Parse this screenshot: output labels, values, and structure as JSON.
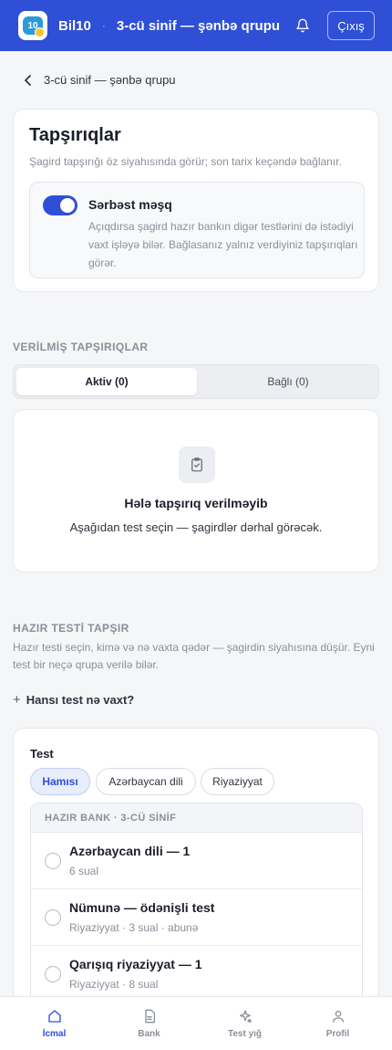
{
  "header": {
    "logo_text": "10",
    "brand": "Bil10",
    "separator": "·",
    "group_title": "3-cü sinif — şənbə qrupu",
    "logout_label": "Çıxış",
    "bell_icon": "bell-icon"
  },
  "breadcrumb": {
    "back_label": "3-cü sinif — şənbə qrupu"
  },
  "tasks_card": {
    "title": "Tapşırıqlar",
    "subtitle": "Şagird tapşırığı öz siyahısında görür; son tarix keçəndə bağlanır.",
    "practice": {
      "enabled": true,
      "title": "Sərbəst məşq",
      "description": "Açıqdırsa şagird hazır bankın digər testlərini də istədiyi vaxt işləyə bilər. Bağlasanız yalnız verdiyiniz tapşırıqları görər."
    }
  },
  "assigned": {
    "section_label": "VERİLMİŞ TAPŞIRIQLAR",
    "tabs": [
      {
        "label": "Aktiv (0)",
        "active": true
      },
      {
        "label": "Bağlı (0)",
        "active": false
      }
    ],
    "empty": {
      "icon": "clipboard-check-icon",
      "title": "Hələ tapşırıq verilməyib",
      "description": "Aşağıdan test seçin — şagirdlər dərhal görəcək."
    }
  },
  "assign": {
    "section_label": "HAZIR TESTİ TAPŞIR",
    "description": "Hazır testi seçin, kimə və nə vaxta qədər — şagirdin siyahısına düşür. Eyni test bir neçə qrupa verilə bilər.",
    "toggle_symbol": "+",
    "toggle_label": "Hansı test nə vaxt?",
    "test_label": "Test",
    "filters": [
      {
        "label": "Hamısı",
        "selected": true
      },
      {
        "label": "Azərbaycan dili",
        "selected": false
      },
      {
        "label": "Riyaziyyat",
        "selected": false
      }
    ],
    "bank_header": "HAZIR BANK · 3-CÜ SİNİF",
    "tests": [
      {
        "title": "Azərbaycan dili — 1",
        "meta": "6 sual"
      },
      {
        "title": "Nümunə — ödənişli test",
        "meta": "Riyaziyyat · 3 sual · abunə"
      },
      {
        "title": "Qarışıq riyaziyyat — 1",
        "meta": "Riyaziyyat · 8 sual"
      }
    ]
  },
  "nav": {
    "items": [
      {
        "label": "İcmal",
        "icon": "home-icon",
        "active": true
      },
      {
        "label": "Bank",
        "icon": "document-icon",
        "active": false
      },
      {
        "label": "Test yığ",
        "icon": "sparkle-icon",
        "active": false
      },
      {
        "label": "Profil",
        "icon": "user-icon",
        "active": false
      }
    ]
  },
  "colors": {
    "primary": "#2e4fd6",
    "background": "#f5f6f8",
    "muted_text": "#8a8f99"
  }
}
